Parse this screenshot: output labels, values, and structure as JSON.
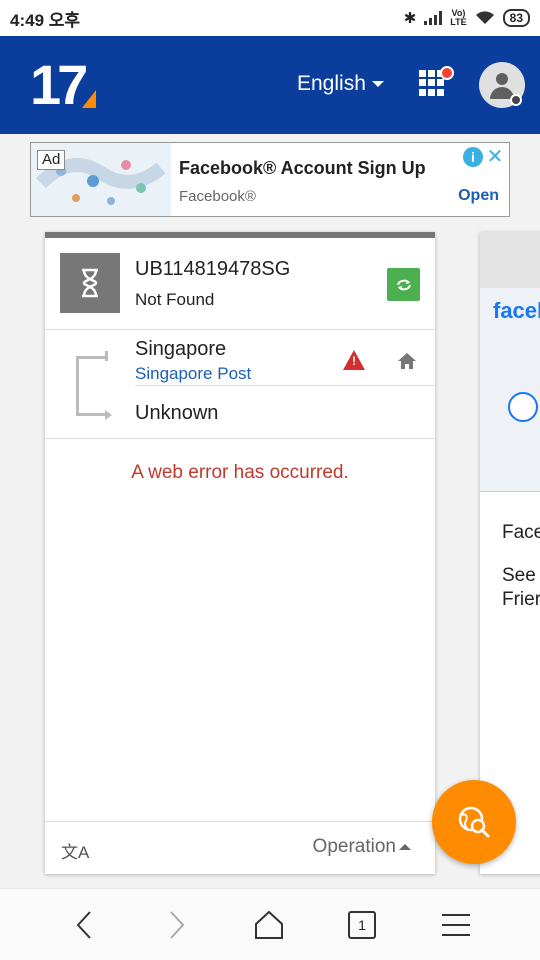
{
  "statusbar": {
    "time": "4:49 오후",
    "battery": "83",
    "network": "LTE"
  },
  "header": {
    "logo_text": "17",
    "language": "English"
  },
  "ad": {
    "badge": "Ad",
    "title": "Facebook® Account Sign Up",
    "advertiser": "Facebook®",
    "cta": "Open"
  },
  "tracking": {
    "number": "UB114819478SG",
    "status": "Not Found",
    "origin_country": "Singapore",
    "carrier": "Singapore Post",
    "destination": "Unknown",
    "error_message": "A web error has occurred.",
    "operation_label": "Operation"
  },
  "side_ad": {
    "brand": "facel",
    "line1": "Face",
    "line2": "See",
    "line3": "Frier"
  },
  "navbar": {
    "tab_count": "1"
  },
  "colors": {
    "brand_blue": "#0a3d9c",
    "accent_orange": "#ff8c00",
    "error_red": "#c0392b",
    "link_blue": "#1a5fb4",
    "success_green": "#4caf50"
  }
}
